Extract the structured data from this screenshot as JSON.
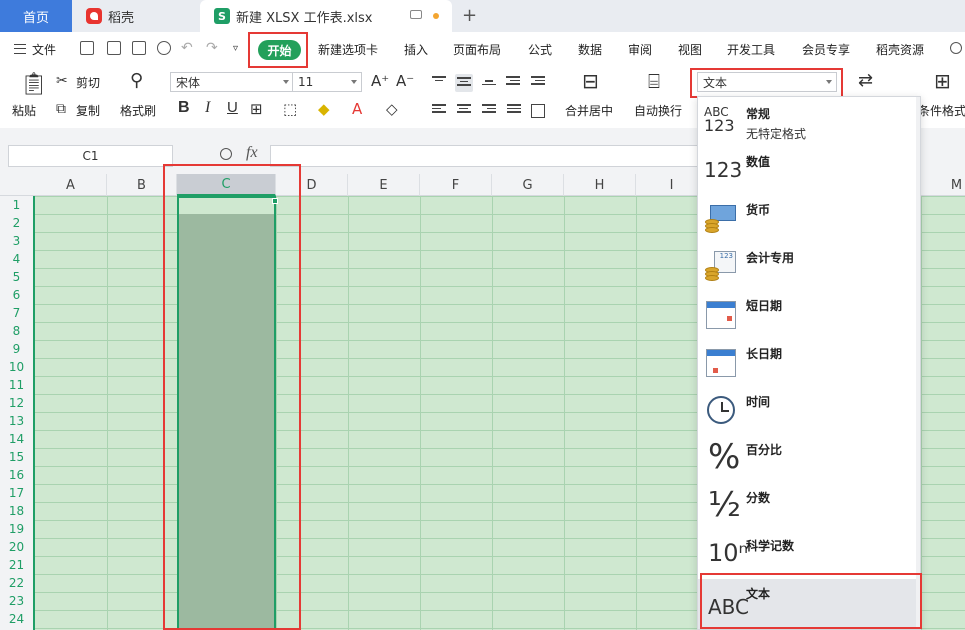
{
  "tabs": {
    "home": "首页",
    "daoke": "稻壳",
    "workbook": "新建 XLSX 工作表.xlsx"
  },
  "menu": {
    "file": "文件",
    "items": [
      "开始",
      "新建选项卡",
      "插入",
      "页面布局",
      "公式",
      "数据",
      "审阅",
      "视图",
      "开发工具",
      "会员专享",
      "稻壳资源"
    ]
  },
  "ribbon": {
    "paste": "粘贴",
    "cut": "剪切",
    "copy": "复制",
    "format_painter": "格式刷",
    "font_name": "宋体",
    "font_size": "11",
    "bold": "B",
    "italic": "I",
    "underline": "U",
    "merge_center": "合并居中",
    "wrap_text": "自动换行",
    "number_format": "文本",
    "conditional_format": "条件格式"
  },
  "formula_bar": {
    "name_box": "C1",
    "fx": "fx",
    "formula": ""
  },
  "grid": {
    "columns": [
      "A",
      "B",
      "C",
      "D",
      "E",
      "F",
      "G",
      "H",
      "I",
      "M"
    ],
    "rows": [
      "1",
      "2",
      "3",
      "4",
      "5",
      "6",
      "7",
      "8",
      "9",
      "10",
      "11",
      "12",
      "13",
      "14",
      "15",
      "16",
      "17",
      "18",
      "19",
      "20",
      "21",
      "22",
      "23",
      "24"
    ],
    "selected_column": "C"
  },
  "number_format_menu": {
    "items": [
      {
        "label": "常规",
        "sub": "无特定格式",
        "icon": "abc-123-icon"
      },
      {
        "label": "数值",
        "sub": "",
        "icon": "number-icon"
      },
      {
        "label": "货币",
        "sub": "",
        "icon": "currency-icon"
      },
      {
        "label": "会计专用",
        "sub": "",
        "icon": "accounting-icon"
      },
      {
        "label": "短日期",
        "sub": "",
        "icon": "short-date-icon"
      },
      {
        "label": "长日期",
        "sub": "",
        "icon": "long-date-icon"
      },
      {
        "label": "时间",
        "sub": "",
        "icon": "clock-icon"
      },
      {
        "label": "百分比",
        "sub": "",
        "icon": "percent-icon"
      },
      {
        "label": "分数",
        "sub": "",
        "icon": "fraction-icon"
      },
      {
        "label": "科学记数",
        "sub": "",
        "icon": "scientific-icon"
      },
      {
        "label": "文本",
        "sub": "",
        "icon": "text-abc-icon"
      }
    ],
    "selected": "文本"
  },
  "icon_glyphs": {
    "abc": "ABC",
    "n123": "123",
    "percent": "%",
    "fraction": "½",
    "scientific": "10ⁿ",
    "text_abc": "ABC",
    "cal_number": "123"
  },
  "colors": {
    "accent": "#1f9e66",
    "highlight": "#e53935",
    "home_tab": "#3e7bdc",
    "sheet_bg": "#cfe8d0"
  }
}
